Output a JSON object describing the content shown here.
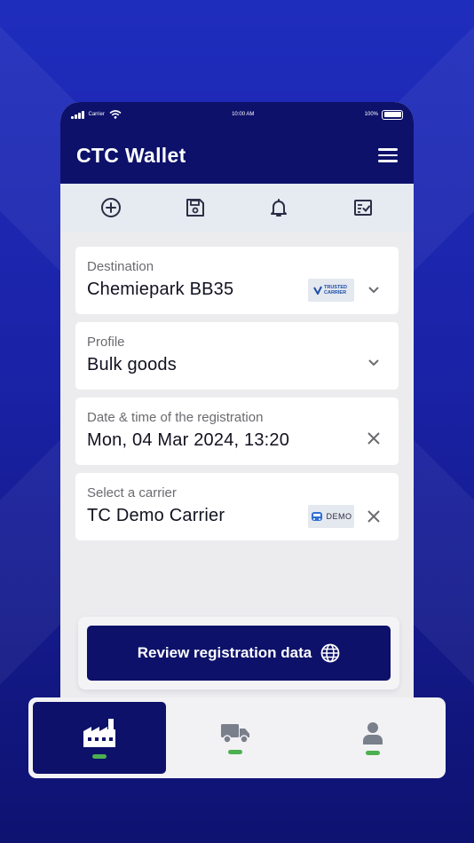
{
  "status_bar": {
    "carrier": "Carrier",
    "time": "10:00 AM",
    "battery": "100%"
  },
  "app": {
    "title": "CTC Wallet"
  },
  "toolbar": {
    "icons": [
      "add-circle-icon",
      "save-icon",
      "bell-icon",
      "checklist-icon"
    ]
  },
  "form": {
    "destination": {
      "label": "Destination",
      "value": "Chemiepark BB35",
      "badge": "TRUSTED CARRIER"
    },
    "profile": {
      "label": "Profile",
      "value": "Bulk goods"
    },
    "datetime": {
      "label": "Date & time of the registration",
      "value": "Mon, 04 Mar 2024, 13:20"
    },
    "carrier": {
      "label": "Select a carrier",
      "value": "TC Demo Carrier",
      "badge": "DEMO"
    }
  },
  "review_button": {
    "label": "Review registration data"
  },
  "bottom_nav": {
    "items": [
      "factory-icon",
      "truck-icon",
      "person-icon"
    ],
    "active_index": 0
  },
  "colors": {
    "primary": "#0d116a",
    "accent": "#4caf50",
    "background": "#1f2dbd"
  }
}
